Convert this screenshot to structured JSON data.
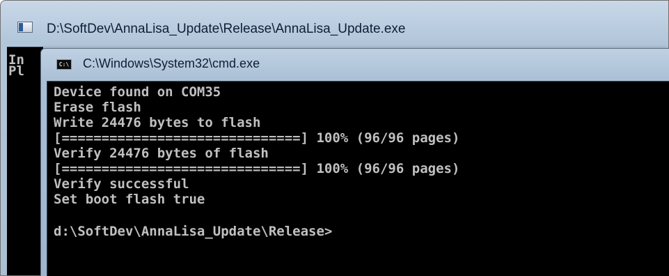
{
  "back_window": {
    "title": "D:\\SoftDev\\AnnaLisa_Update\\Release\\AnnaLisa_Update.exe",
    "visible_text": [
      "In",
      "Pl"
    ]
  },
  "cmd_window": {
    "icon_label": "C:\\",
    "title": "C:\\Windows\\System32\\cmd.exe",
    "lines": [
      "Device found on COM35",
      "Erase flash",
      "Write 24476 bytes to flash",
      "[==============================] 100% (96/96 pages)",
      "Verify 24476 bytes of flash",
      "[==============================] 100% (96/96 pages)",
      "Verify successful",
      "Set boot flash true",
      "",
      "d:\\SoftDev\\AnnaLisa_Update\\Release>"
    ]
  }
}
